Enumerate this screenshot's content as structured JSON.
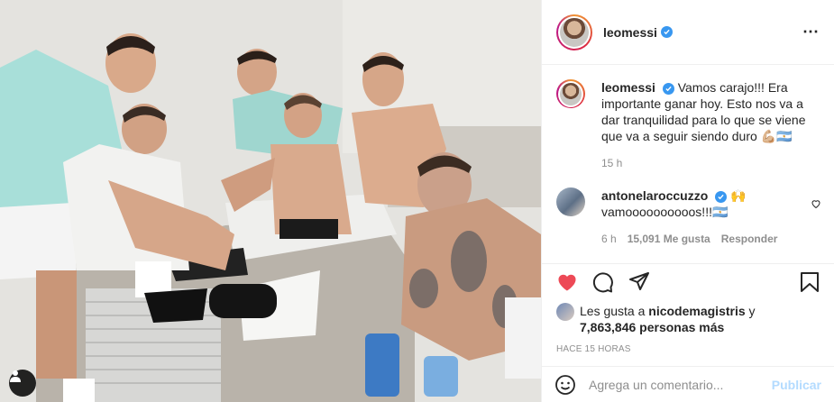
{
  "post": {
    "author": "leomessi",
    "verified": true,
    "caption_user": "leomessi",
    "caption": "Vamos carajo!!! Era importante ganar hoy. Esto nos va a dar tranquilidad para lo que se viene que va a seguir siendo duro 💪🏼🇦🇷",
    "caption_age": "15 h",
    "more_icon": "⋯"
  },
  "comment": {
    "user": "antonelaroccuzzo",
    "text_emoji": "🙌",
    "text": "vamoooooooooos!!!🇦🇷",
    "age": "6 h",
    "likes": "15,091 Me gusta",
    "reply": "Responder"
  },
  "likes_summary": {
    "prefix": "Les gusta a",
    "user": "nicodemagistris",
    "connector": "y",
    "count": "7,863,846 personas más"
  },
  "timestamp": "HACE 15 HORAS",
  "comment_box": {
    "placeholder": "Agrega un comentario...",
    "publish": "Publicar"
  },
  "colors": {
    "like_red": "#ed4956",
    "verified_blue": "#3897f0",
    "publish_disabled": "#b3dbff"
  },
  "icons": [
    "user-tag-icon",
    "more-options-icon",
    "verified-badge-icon",
    "heart-icon",
    "comment-icon",
    "share-icon",
    "save-icon",
    "emoji-icon",
    "small-heart-icon"
  ]
}
